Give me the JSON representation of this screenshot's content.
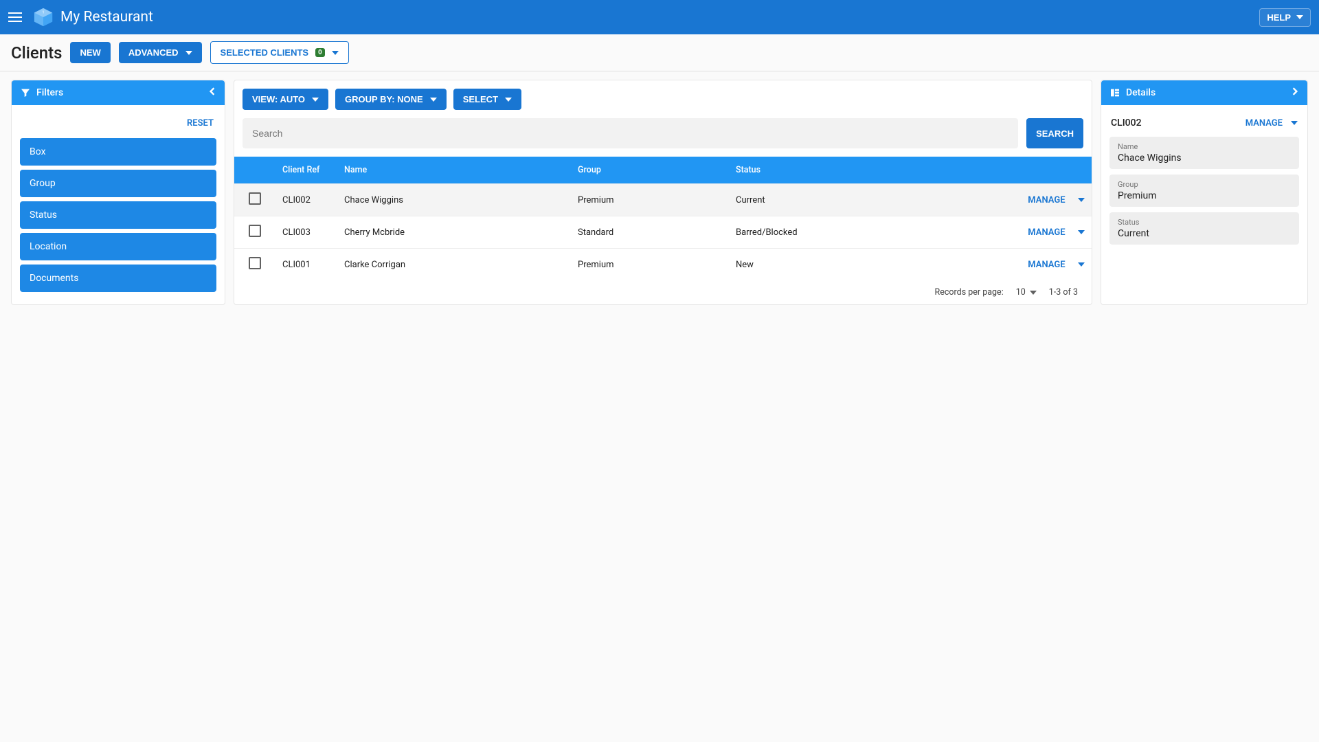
{
  "appbar": {
    "title": "My Restaurant",
    "help": "HELP"
  },
  "page": {
    "title": "Clients",
    "new": "NEW",
    "advanced": "ADVANCED",
    "selected_clients": "SELECTED CLIENTS",
    "selected_count": "0"
  },
  "filters": {
    "title": "Filters",
    "reset": "RESET",
    "items": [
      "Box",
      "Group",
      "Status",
      "Location",
      "Documents"
    ]
  },
  "toolbar": {
    "view": "VIEW: AUTO",
    "group_by": "GROUP BY: NONE",
    "select": "SELECT"
  },
  "search": {
    "placeholder": "Search",
    "button": "SEARCH"
  },
  "table": {
    "headers": {
      "ref": "Client Ref",
      "name": "Name",
      "group": "Group",
      "status": "Status"
    },
    "rows": [
      {
        "ref": "CLI002",
        "name": "Chace Wiggins",
        "group": "Premium",
        "status": "Current",
        "selected": true
      },
      {
        "ref": "CLI003",
        "name": "Cherry Mcbride",
        "group": "Standard",
        "status": "Barred/Blocked",
        "selected": false
      },
      {
        "ref": "CLI001",
        "name": "Clarke Corrigan",
        "group": "Premium",
        "status": "New",
        "selected": false
      }
    ],
    "manage": "MANAGE",
    "footer": {
      "label": "Records per page:",
      "per_page": "10",
      "range": "1-3 of 3"
    }
  },
  "details": {
    "title": "Details",
    "ref": "CLI002",
    "manage": "MANAGE",
    "fields": [
      {
        "label": "Name",
        "value": "Chace Wiggins"
      },
      {
        "label": "Group",
        "value": "Premium"
      },
      {
        "label": "Status",
        "value": "Current"
      }
    ]
  }
}
